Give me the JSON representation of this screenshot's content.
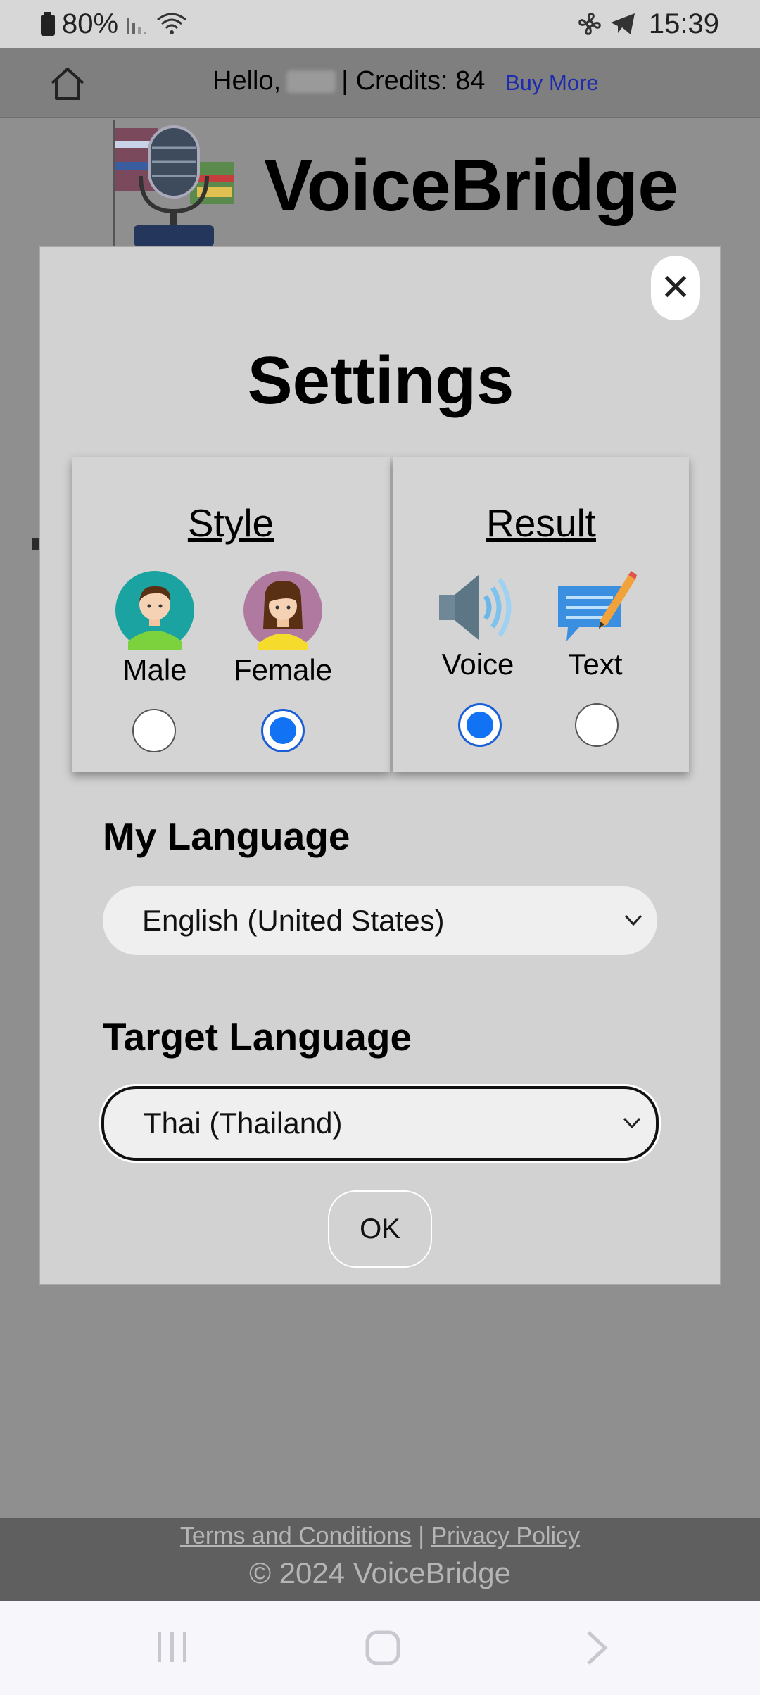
{
  "status_bar": {
    "battery": "80%",
    "time": "15:39"
  },
  "header": {
    "greeting_prefix": "Hello,",
    "credits_text": "| Credits: 84",
    "buy_more": "Buy More"
  },
  "brand": {
    "title": "VoiceBridge"
  },
  "settings": {
    "title": "Settings",
    "close": "✕",
    "style": {
      "title": "Style",
      "options": [
        {
          "label": "Male",
          "selected": false
        },
        {
          "label": "Female",
          "selected": true
        }
      ]
    },
    "result": {
      "title": "Result",
      "options": [
        {
          "label": "Voice",
          "selected": true
        },
        {
          "label": "Text",
          "selected": false
        }
      ]
    },
    "my_language": {
      "label": "My Language",
      "value": "English (United States)"
    },
    "target_language": {
      "label": "Target Language",
      "value": "Thai (Thailand)"
    },
    "ok": "OK"
  },
  "footer": {
    "terms": "Terms and Conditions",
    "separator": "|",
    "privacy": "Privacy Policy",
    "copyright": "© 2024 VoiceBridge"
  },
  "colors": {
    "accent": "#1172f4",
    "link": "#1c2bb0",
    "overlay": "#8f8f8f"
  }
}
